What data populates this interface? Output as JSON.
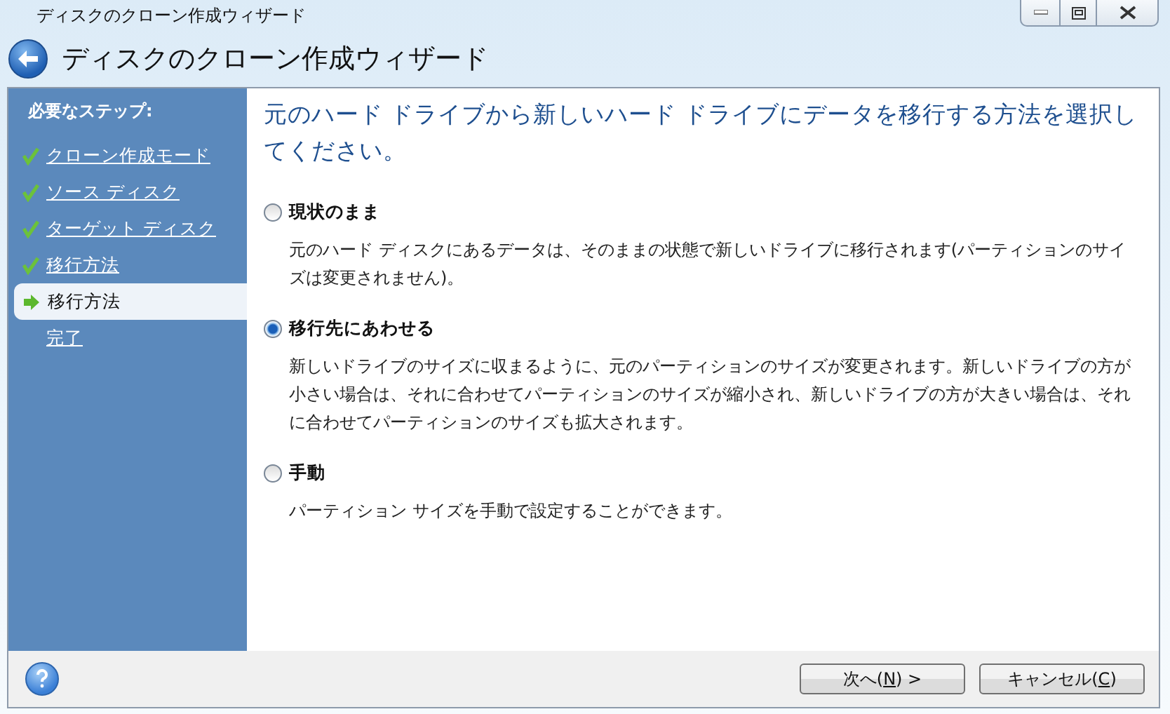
{
  "window": {
    "title": "ディスクのクローン作成ウィザード"
  },
  "header": {
    "title": "ディスクのクローン作成ウィザード"
  },
  "sidebar": {
    "heading": "必要なステップ:",
    "steps": [
      {
        "label": "クローン作成モード",
        "kind": "done",
        "selected": false
      },
      {
        "label": "ソース ディスク",
        "kind": "done",
        "selected": false
      },
      {
        "label": "ターゲット ディスク",
        "kind": "done",
        "selected": false
      },
      {
        "label": "移行方法",
        "kind": "done",
        "selected": false
      },
      {
        "label": "移行方法",
        "kind": "current",
        "selected": true
      },
      {
        "label": "完了",
        "kind": "pending",
        "selected": false
      }
    ]
  },
  "content": {
    "heading": "元のハード ドライブから新しいハード ドライブにデータを移行する方法を選択してください。",
    "options": [
      {
        "label": "現状のまま",
        "selected": false,
        "description": "元のハード ディスクにあるデータは、そのままの状態で新しいドライブに移行されます(パーティションのサイズは変更されません)。"
      },
      {
        "label": "移行先にあわせる",
        "selected": true,
        "description": "新しいドライブのサイズに収まるように、元のパーティションのサイズが変更されます。新しいドライブの方が小さい場合は、それに合わせてパーティションのサイズが縮小され、新しいドライブの方が大きい場合は、それに合わせてパーティションのサイズも拡大されます。"
      },
      {
        "label": "手動",
        "selected": false,
        "description": "パーティション サイズを手動で設定することができます。"
      }
    ]
  },
  "footer": {
    "buttons": [
      {
        "before": "次へ(",
        "key": "N",
        "after": ") >"
      },
      {
        "before": "キャンセル(",
        "key": "C",
        "after": ")"
      }
    ]
  }
}
